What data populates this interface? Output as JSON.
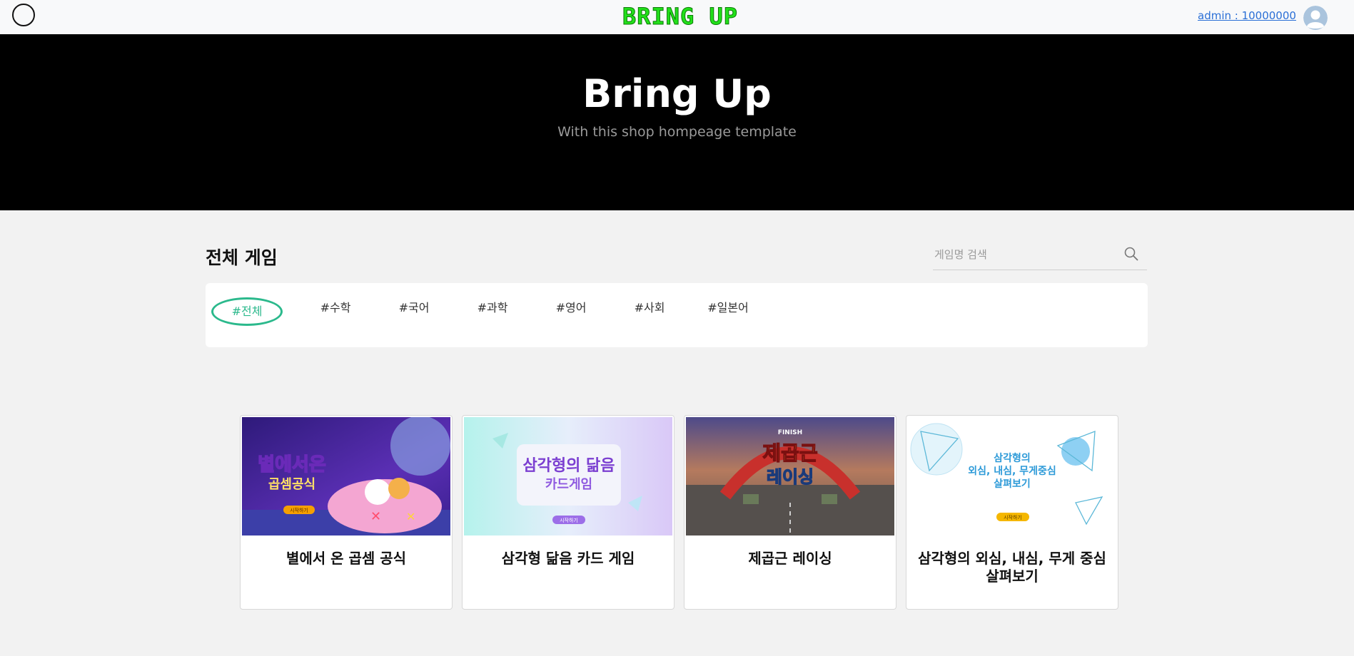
{
  "header": {
    "logo_text": "BRING UP",
    "admin_link": "admin : 10000000",
    "colors": {
      "logo": "#22e01a",
      "link": "#2a6fd6"
    }
  },
  "hero": {
    "title": "Bring Up",
    "subtitle": "With this shop hompeage template"
  },
  "section": {
    "title": "전체 게임",
    "search_placeholder": "게임명 검색"
  },
  "tags": [
    {
      "label": "#전체",
      "active": true
    },
    {
      "label": "#수학",
      "active": false
    },
    {
      "label": "#국어",
      "active": false
    },
    {
      "label": "#과학",
      "active": false
    },
    {
      "label": "#영어",
      "active": false
    },
    {
      "label": "#사회",
      "active": false
    },
    {
      "label": "#일본어",
      "active": false
    }
  ],
  "accent_color": "#2bb98c",
  "games": [
    {
      "title": "별에서 온 곱셈 공식",
      "thumb_line1": "별에서온",
      "thumb_line2": "곱셈공식",
      "thumb_button": "시작하기"
    },
    {
      "title": "삼각형 닮음 카드 게임",
      "thumb_line1": "삼각형의 닮음",
      "thumb_line2": "카드게임",
      "thumb_button": "시작하기"
    },
    {
      "title": "제곱근 레이싱",
      "thumb_line1": "제곱근",
      "thumb_line2": "레이싱",
      "thumb_banner": "FINISH"
    },
    {
      "title": "삼각형의 외심, 내심, 무게 중심 살펴보기",
      "thumb_line1": "삼각형의",
      "thumb_line2": "외심, 내심, 무게중심",
      "thumb_line3": "살펴보기",
      "thumb_button": "시작하기"
    }
  ]
}
